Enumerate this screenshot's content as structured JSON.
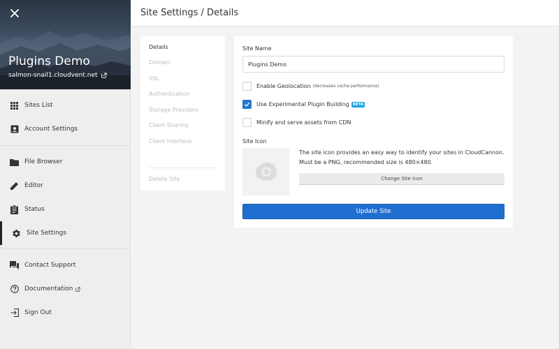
{
  "site": {
    "name": "Plugins Demo",
    "url": "salmon-snail1.cloudvent.net"
  },
  "header": {
    "breadcrumb": "Site Settings / Details"
  },
  "sidebar": {
    "group1": [
      {
        "label": "Sites List",
        "icon": "grid-icon"
      },
      {
        "label": "Account Settings",
        "icon": "account-card-icon"
      }
    ],
    "group2": [
      {
        "label": "File Browser",
        "icon": "folder-icon"
      },
      {
        "label": "Editor",
        "icon": "pencil-icon"
      },
      {
        "label": "Status",
        "icon": "clipboard-icon"
      },
      {
        "label": "Site Settings",
        "icon": "gear-icon",
        "active": true
      }
    ],
    "group3": [
      {
        "label": "Contact Support",
        "icon": "chat-icon"
      },
      {
        "label": "Documentation",
        "icon": "help-circle-icon",
        "external": true
      },
      {
        "label": "Sign Out",
        "icon": "sign-out-icon"
      }
    ]
  },
  "settings_menu": {
    "items": [
      "Details",
      "Domain",
      "SSL",
      "Authentication",
      "Storage Providers",
      "Client Sharing",
      "Client Interface"
    ],
    "danger": "Delete Site",
    "active_index": 0
  },
  "details": {
    "site_name_label": "Site Name",
    "site_name_value": "Plugins Demo",
    "geolocation_label": "Enable Geolocation",
    "geolocation_note": "(decreases cache performance)",
    "geolocation_checked": false,
    "plugin_building_label": "Use Experimental Plugin Building",
    "plugin_building_badge": "BETA",
    "plugin_building_checked": true,
    "minify_label": "Minify and serve assets from CDN",
    "minify_checked": false,
    "site_icon_label": "Site Icon",
    "site_icon_desc_1": "The site icon provides an easy way to identify your sites in CloudCannon.",
    "site_icon_desc_2": "Must be a PNG, recommended size is 480×480.",
    "change_icon_button": "Change Site Icon",
    "update_button": "Update Site"
  },
  "colors": {
    "accent": "#1f6fd1",
    "badge": "#1aa3e0",
    "sidebar_bg": "#eeeeee"
  }
}
